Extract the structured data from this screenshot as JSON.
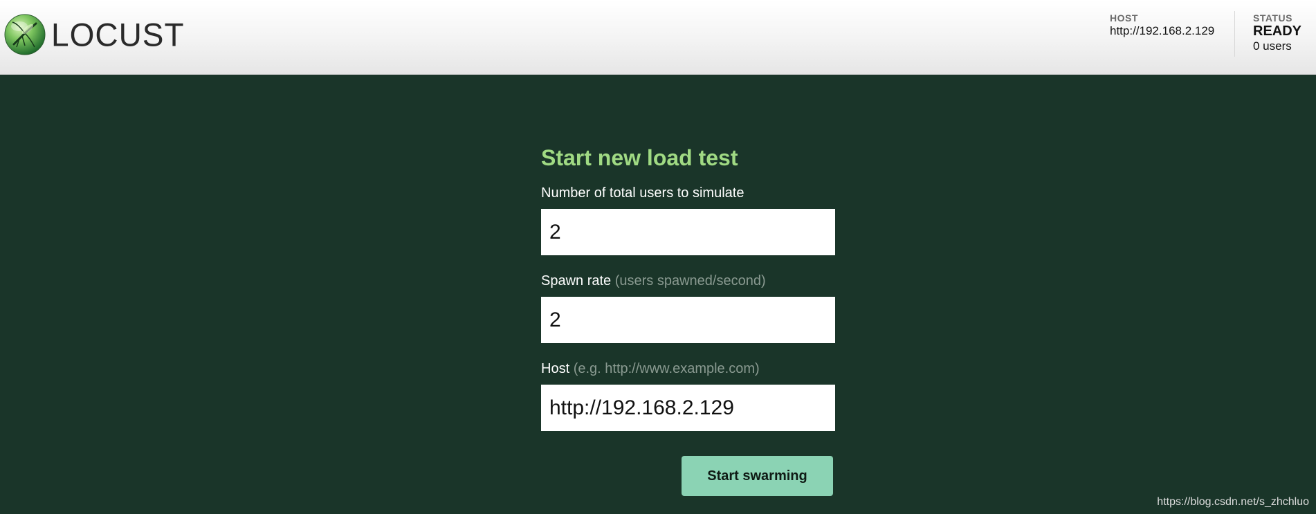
{
  "brand": {
    "name": "LOCUST",
    "logo_icon": "locust-logo-icon"
  },
  "header": {
    "host": {
      "label": "HOST",
      "value": "http://192.168.2.129"
    },
    "status": {
      "label": "STATUS",
      "value": "READY",
      "users": "0 users"
    }
  },
  "form": {
    "title": "Start new load test",
    "users": {
      "label": "Number of total users to simulate",
      "value": "2"
    },
    "spawn": {
      "label": "Spawn rate",
      "hint": "(users spawned/second)",
      "value": "2"
    },
    "host": {
      "label": "Host",
      "hint": "(e.g. http://www.example.com)",
      "value": "http://192.168.2.129"
    },
    "submit_label": "Start swarming"
  },
  "watermark": "https://blog.csdn.net/s_zhchluo",
  "colors": {
    "header_bg": "#f3f3f3",
    "page_bg": "#1a3529",
    "title": "#a0da83",
    "button": "#8bd3b4"
  }
}
